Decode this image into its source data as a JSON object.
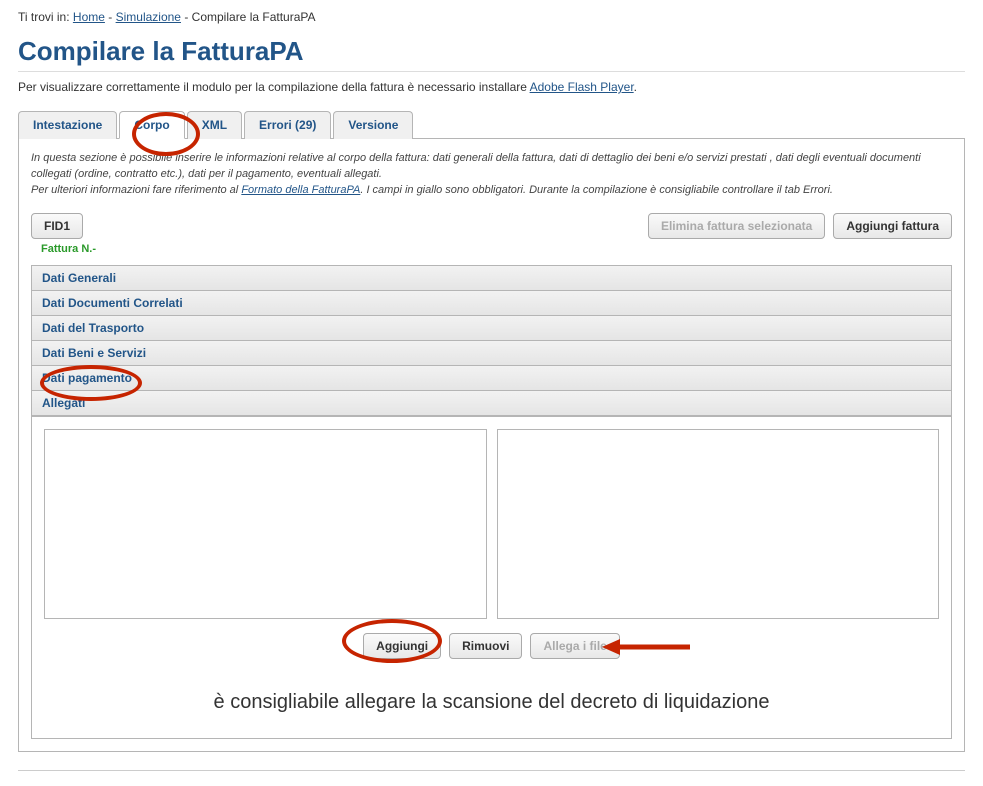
{
  "breadcrumb": {
    "prefix": "Ti trovi in: ",
    "links": [
      {
        "label": "Home"
      },
      {
        "label": "Simulazione"
      }
    ],
    "sep": " - ",
    "current": "Compilare la FatturaPA"
  },
  "heading": "Compilare la FatturaPA",
  "subtitle": {
    "text": "Per visualizzare correttamente il modulo per la compilazione della fattura è necessario installare ",
    "link": "Adobe Flash Player",
    "suffix": "."
  },
  "tabs": {
    "items": [
      {
        "label": "Intestazione"
      },
      {
        "label": "Corpo",
        "active": true
      },
      {
        "label": "XML"
      },
      {
        "label": "Errori (29)"
      },
      {
        "label": "Versione"
      }
    ]
  },
  "description": {
    "line1": "In questa sezione è possibile inserire le informazioni relative al corpo della fattura: dati generali della fattura, dati di dettaglio dei beni e/o servizi prestati , dati degli eventuali documenti collegati (ordine, contratto etc.), dati per il pagamento, eventuali allegati.",
    "line2_pre": "Per ulteriori informazioni fare riferimento al ",
    "line2_link": "Formato della FatturaPA",
    "line2_post": ". I campi in giallo sono obbligatori. Durante la compilazione è consigliabile controllare il tab Errori."
  },
  "toolbar": {
    "fid_label": "FID1",
    "fattura_label": "Fattura N.-",
    "delete_label": "Elimina fattura selezionata",
    "add_label": "Aggiungi fattura"
  },
  "accordion": {
    "items": [
      {
        "label": "Dati Generali"
      },
      {
        "label": "Dati Documenti Correlati"
      },
      {
        "label": "Dati del Trasporto"
      },
      {
        "label": "Dati Beni e Servizi"
      },
      {
        "label": "Dati pagamento"
      },
      {
        "label": "Allegati",
        "open": true
      }
    ]
  },
  "attach_buttons": {
    "add": "Aggiungi",
    "remove": "Rimuovi",
    "attach": "Allega i file"
  },
  "annotation_note": "è consigliabile allegare la scansione del decreto di liquidazione"
}
